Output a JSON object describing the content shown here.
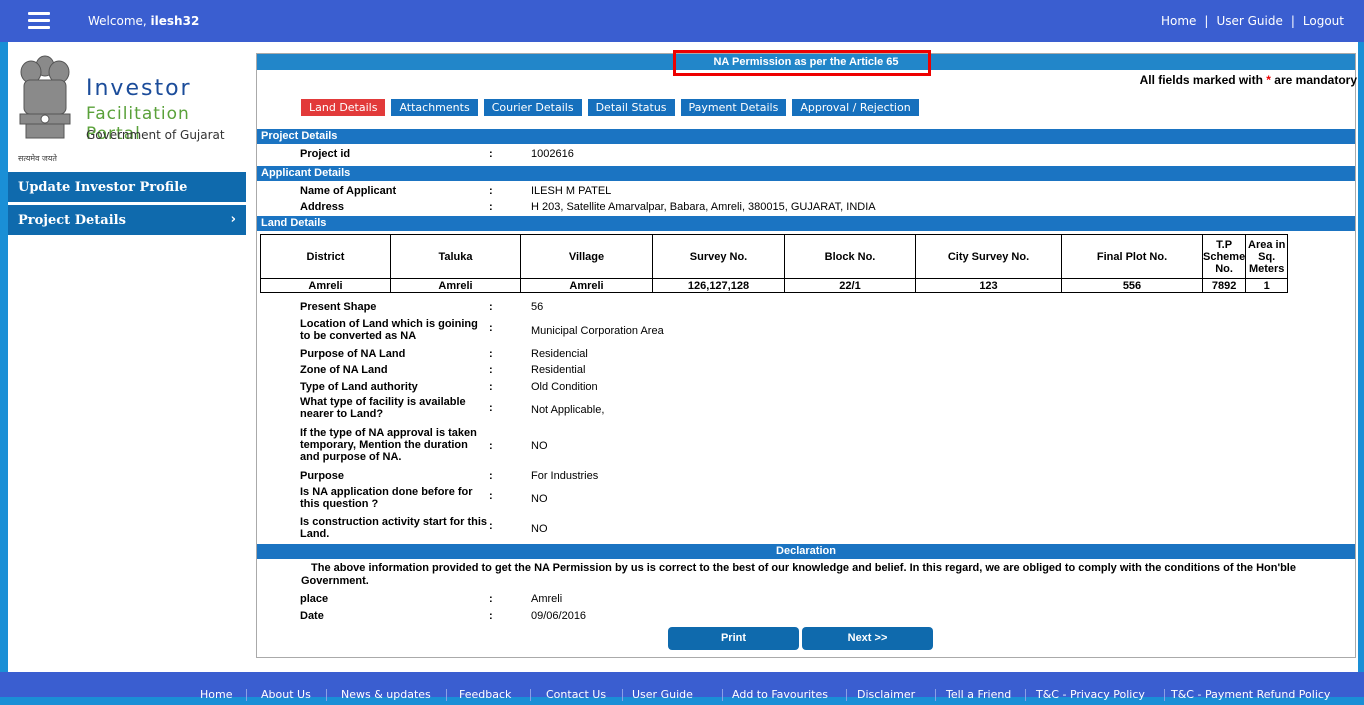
{
  "header": {
    "welcome_prefix": "Welcome,",
    "username": "ilesh32",
    "menu_icon": "hamburger-menu-icon",
    "links": [
      "Home",
      "User Guide",
      "Logout"
    ]
  },
  "logo": {
    "line1": "Investor",
    "line2": "Facilitation Portal",
    "line3": "Government of Gujarat",
    "motto": "सत्यमेव जयते"
  },
  "sidebar": {
    "items": [
      {
        "label": "Update Investor Profile"
      },
      {
        "label": "Project Details",
        "chevron": "›"
      }
    ]
  },
  "main": {
    "title": "NA Permission as per the Article 65",
    "mandatory_prefix": "All fields marked with",
    "mandatory_star": "*",
    "mandatory_suffix": "are mandatory",
    "tabs": [
      "Land Details",
      "Attachments",
      "Courier Details",
      "Detail Status",
      "Payment Details",
      "Approval / Rejection"
    ],
    "active_tab": "Land Details",
    "sections": {
      "project": "Project Details",
      "applicant": "Applicant Details",
      "land": "Land Details",
      "declaration": "Declaration"
    },
    "project_id_label": "Project id",
    "project_id": "1002616",
    "applicant_name_label": "Name of Applicant",
    "applicant_name": "ILESH M PATEL",
    "address_label": "Address",
    "address": "H 203, Satellite Amarvalpar, Babara, Amreli, 380015, GUJARAT, INDIA",
    "land_table": {
      "headers": [
        "District",
        "Taluka",
        "Village",
        "Survey No.",
        "Block No.",
        "City Survey No.",
        "Final Plot No.",
        "T.P Scheme No.",
        "Area in Sq. Meters"
      ],
      "row": [
        "Amreli",
        "Amreli",
        "Amreli",
        "126,127,128",
        "22/1",
        "123",
        "556",
        "7892",
        "1"
      ]
    },
    "land_fields": [
      {
        "label": "Present Shape",
        "value": "56"
      },
      {
        "label": "Location of Land which is goining to be converted as NA",
        "value": "Municipal Corporation Area"
      },
      {
        "label": "Purpose of NA Land",
        "value": "Residencial"
      },
      {
        "label": "Zone of NA Land",
        "value": "Residential"
      },
      {
        "label": "Type of Land authority",
        "value": "Old Condition"
      },
      {
        "label": "What type of facility is available nearer to Land?",
        "value": "Not Applicable,"
      },
      {
        "label": "If the type of NA approval is taken temporary, Mention the duration and purpose of NA.",
        "value": "NO"
      },
      {
        "label": "Purpose",
        "value": "For Industries"
      },
      {
        "label": "Is NA application done before for this question ?",
        "value": "NO"
      },
      {
        "label": "Is construction activity start for this Land.",
        "value": "NO"
      }
    ],
    "declaration_text": "The above information provided to get the NA Permission by us is correct to the best of our knowledge and belief. In this regard, we are obliged to comply with the conditions of the Hon'ble Government.",
    "place_label": "place",
    "place": "Amreli",
    "date_label": "Date",
    "date": "09/06/2016",
    "print_label": "Print",
    "next_label": "Next >>",
    "colon": ":"
  },
  "footer": {
    "links": [
      "Home",
      "About Us",
      "News & updates",
      "Feedback",
      "Contact Us",
      "User Guide",
      "Add to Favourites",
      "Disclaimer",
      "Tell a Friend",
      "T&C - Privacy Policy",
      "T&C - Payment Refund Policy"
    ]
  },
  "colors": {
    "header_bg": "#3a5ed0",
    "section_bar": "#1b74c2",
    "active_tab": "#e23a3a",
    "highlight_box": "#ee0000"
  }
}
